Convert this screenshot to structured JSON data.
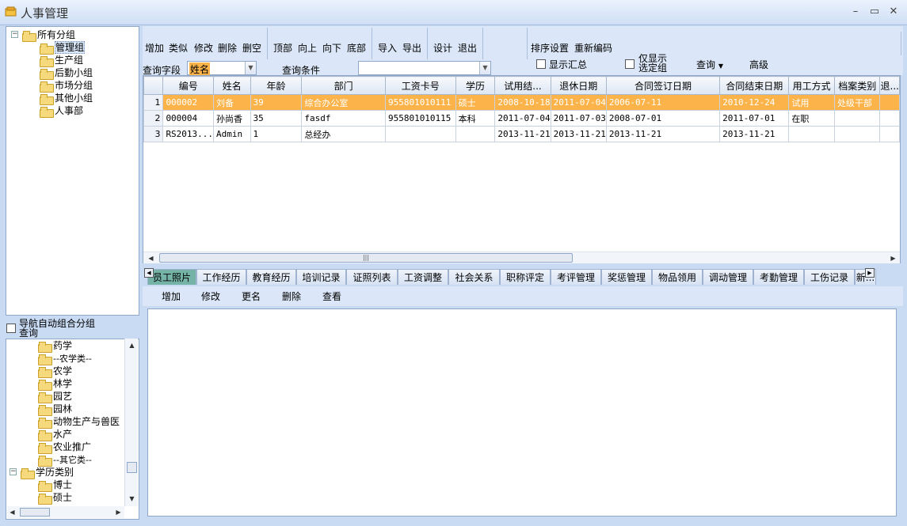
{
  "window": {
    "title": "人事管理",
    "minimize": "–",
    "maximize": "▭",
    "close": "✕"
  },
  "tree_top": [
    {
      "label": "所有分组",
      "level": 0,
      "expander": "−"
    },
    {
      "label": "管理组",
      "level": 1,
      "selected": true
    },
    {
      "label": "生产组",
      "level": 1
    },
    {
      "label": "后勤小组",
      "level": 1
    },
    {
      "label": "市场分组",
      "level": 1
    },
    {
      "label": "其他小组",
      "level": 1
    },
    {
      "label": "人事部",
      "level": 1
    }
  ],
  "nav_auto": {
    "label_line1": "导航自动组合分组",
    "label_line2": "查询"
  },
  "tree_bottom": [
    {
      "label": "药学",
      "level": 2
    },
    {
      "label": "--农学类--",
      "level": 2
    },
    {
      "label": "农学",
      "level": 2
    },
    {
      "label": "林学",
      "level": 2
    },
    {
      "label": "园艺",
      "level": 2
    },
    {
      "label": "园林",
      "level": 2
    },
    {
      "label": "动物生产与兽医",
      "level": 2
    },
    {
      "label": "水产",
      "level": 2
    },
    {
      "label": "农业推广",
      "level": 2
    },
    {
      "label": "--其它类--",
      "level": 2
    },
    {
      "label": "学历类别",
      "level": 1,
      "expander": "−"
    },
    {
      "label": "博士",
      "level": 2
    },
    {
      "label": "硕士",
      "level": 2
    }
  ],
  "toolbar": {
    "group1": [
      "增加",
      "类似",
      "修改",
      "删除",
      "删空"
    ],
    "group2": [
      "顶部",
      "向上",
      "向下",
      "底部"
    ],
    "group3": [
      "导入",
      "导出"
    ],
    "group4": [
      "设计",
      "退出"
    ],
    "sort_settings": "排序设置",
    "renumber": "重新编码",
    "query_field_label": "查询字段",
    "query_field_value": "姓名",
    "query_condition_label": "查询条件",
    "query_condition_value": "",
    "show_summary": "显示汇总",
    "only_show_line1": "仅显示",
    "only_show_line2": "选定组",
    "query": "查询",
    "advanced": "高级"
  },
  "grid": {
    "columns": [
      "编号",
      "姓名",
      "年龄",
      "部门",
      "工资卡号",
      "学历",
      "试用结...",
      "退休日期",
      "合同签订日期",
      "合同结束日期",
      "用工方式",
      "档案类别",
      "退..."
    ],
    "rows": [
      {
        "n": "1",
        "cells": [
          "000002",
          "刘备",
          "39",
          "综合办公室",
          "955801010111",
          "硕士",
          "2008-10-18",
          "2011-07-04",
          "2006-07-11",
          "2010-12-24",
          "试用",
          "处级干部",
          ""
        ]
      },
      {
        "n": "2",
        "cells": [
          "000004",
          "孙尚香",
          "35",
          "fasdf",
          "955801010115",
          "本科",
          "2011-07-04",
          "2011-07-03",
          "2008-07-01",
          "2011-07-01",
          "在职",
          "",
          ""
        ]
      },
      {
        "n": "3",
        "cells": [
          "RS2013...",
          "Admin",
          "1",
          "总经办",
          "",
          "",
          "2013-11-21",
          "2013-11-21",
          "2013-11-21",
          "2013-11-21",
          "",
          "",
          ""
        ]
      }
    ],
    "highlight_color": "#fbb34a"
  },
  "tabs": [
    "员工照片",
    "工作经历",
    "教育经历",
    "培训记录",
    "证照列表",
    "工资调整",
    "社会关系",
    "职称评定",
    "考评管理",
    "奖惩管理",
    "物品领用",
    "调动管理",
    "考勤管理",
    "工伤记录",
    "新..."
  ],
  "subbar": [
    "增加",
    "修改",
    "更名",
    "删除",
    "查看"
  ]
}
